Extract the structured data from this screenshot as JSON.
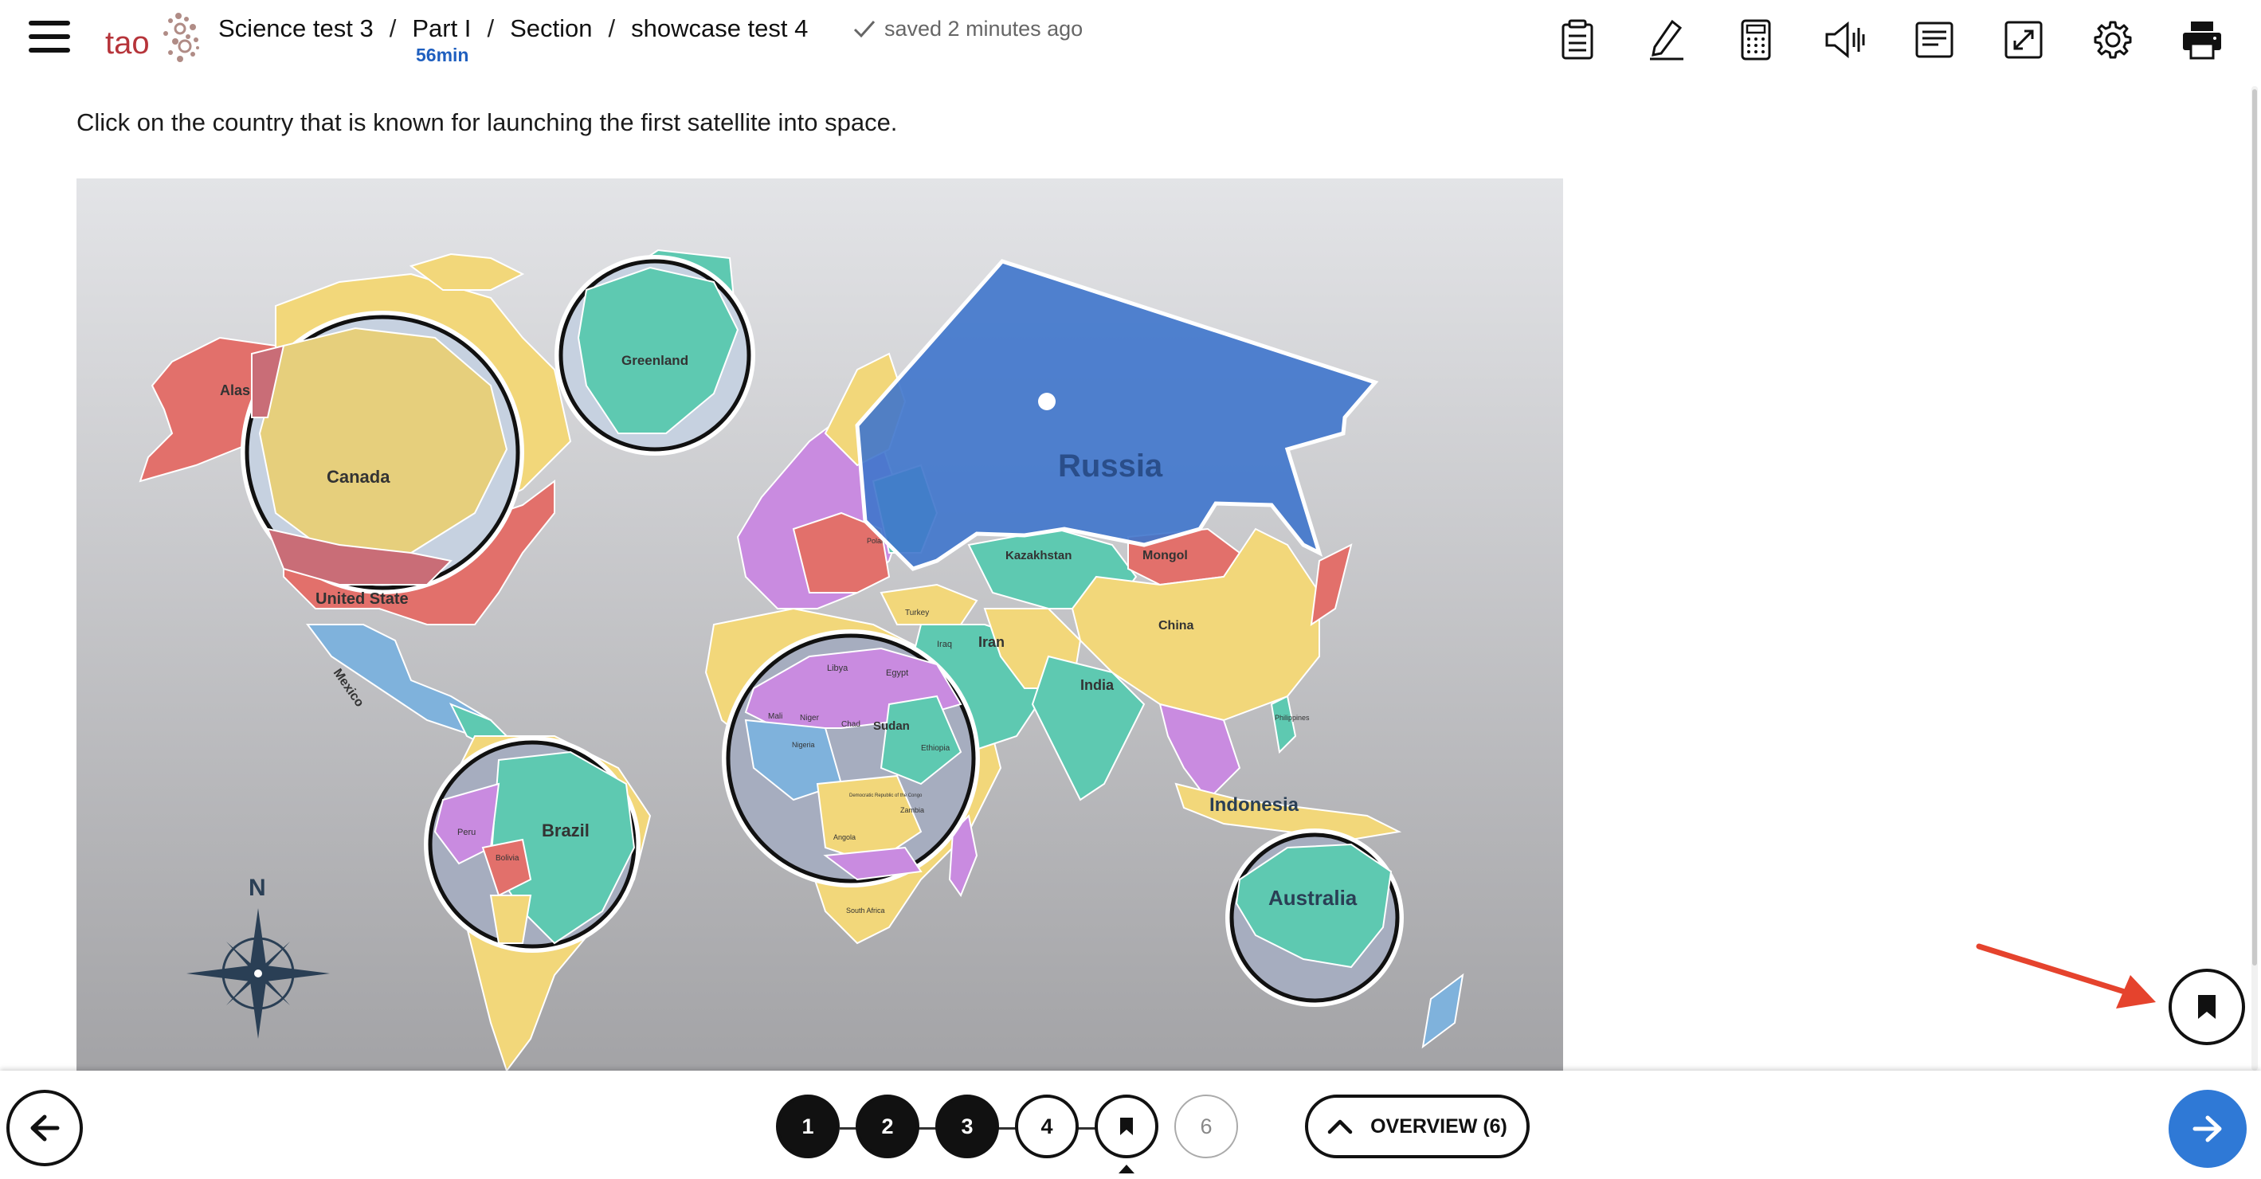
{
  "header": {
    "logo_text": "tao",
    "breadcrumb": [
      "Science test 3",
      "Part I",
      "Section",
      "showcase test 4"
    ],
    "separator": "/",
    "timer": "56min",
    "save_status": "saved 2 minutes ago"
  },
  "toolbar": {
    "tools": [
      "answer-masking-icon",
      "highlighter-icon",
      "calculator-icon",
      "text-to-speech-icon",
      "line-reader-icon",
      "fullscreen-icon",
      "settings-icon",
      "print-icon"
    ]
  },
  "question": {
    "prompt": "Click on the country that is known for launching the first satellite into space."
  },
  "map": {
    "selected_country": "Russia",
    "labels": {
      "russia": "Russia",
      "canada": "Canada",
      "alaska": "Alas",
      "united_states": "United State",
      "mexico": "Mexico",
      "greenland": "Greenland",
      "brazil": "Brazil",
      "peru": "Peru",
      "bolivia": "Bolivia",
      "kazakhstan": "Kazakhstan",
      "mongol": "Mongol",
      "china": "China",
      "iran": "Iran",
      "iraq": "Iraq",
      "india": "India",
      "indonesia": "Indonesia",
      "philippines": "Philippines",
      "australia": "Australia",
      "libya": "Libya",
      "egypt": "Egypt",
      "sudan": "Sudan",
      "ethiopia": "Ethiopia",
      "mali": "Mali",
      "niger": "Niger",
      "chad": "Chad",
      "nigeria": "Nigeria",
      "congo": "Democratic Republic of the Congo",
      "zambia": "Zambia",
      "angola": "Angola",
      "south_africa": "South Africa",
      "poland": "Poland",
      "turkey": "Turkey",
      "compass_north": "N"
    },
    "colors": {
      "selected_fill": "#3f76cc",
      "yellow": "#f2d77a",
      "red": "#e2706b",
      "teal": "#5ec9b1",
      "purple": "#c98be0",
      "blue": "#7fb2dc",
      "sea_top": "#e3e4e7",
      "sea_bottom": "#a3a3a6"
    }
  },
  "navigation": {
    "items": [
      {
        "label": "1",
        "state": "done"
      },
      {
        "label": "2",
        "state": "done"
      },
      {
        "label": "3",
        "state": "done"
      },
      {
        "label": "4",
        "state": "open"
      },
      {
        "label": "",
        "state": "current-flagged"
      },
      {
        "label": "6",
        "state": "future"
      }
    ],
    "overview_label": "OVERVIEW (6)"
  },
  "colors": {
    "accent_blue": "#2f79d6",
    "brand_red": "#b6343a",
    "annotation_arrow": "#e5432d"
  }
}
